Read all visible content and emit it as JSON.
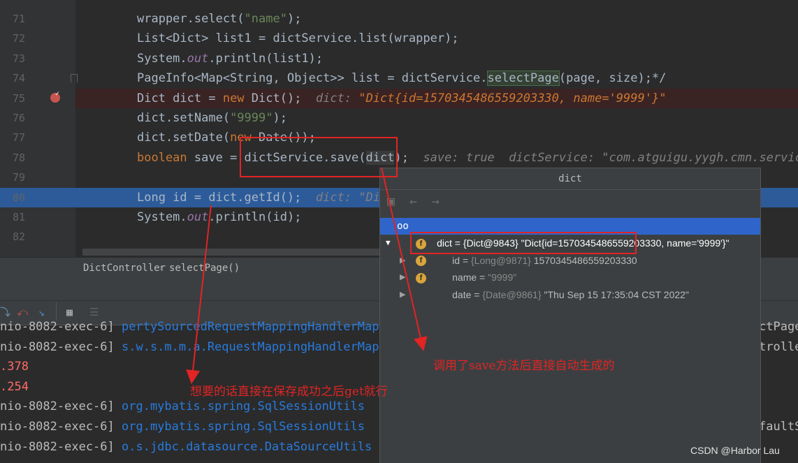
{
  "editor": {
    "lines": [
      {
        "no": "71",
        "segments": [
          {
            "t": "wrapper.select(",
            "c": ""
          },
          {
            "t": "\"name\"",
            "c": "str"
          },
          {
            "t": ");",
            "c": ""
          }
        ]
      },
      {
        "no": "72",
        "segments": [
          {
            "t": "List<Dict> list1 = dictService.list(wrapper);",
            "c": ""
          }
        ]
      },
      {
        "no": "73",
        "segments": [
          {
            "t": "System.",
            "c": ""
          },
          {
            "t": "out",
            "c": "it"
          },
          {
            "t": ".println(list1);",
            "c": ""
          }
        ]
      },
      {
        "no": "74",
        "segments": [
          {
            "t": "PageInfo<Map<String, Object>> list = dictService.",
            "c": ""
          },
          {
            "t": "selectPage",
            "c": "hl-sel"
          },
          {
            "t": "(page, size);*/",
            "c": ""
          }
        ]
      },
      {
        "no": "75",
        "segments": [
          {
            "t": "Dict dict = ",
            "c": ""
          },
          {
            "t": "new",
            "c": "kw"
          },
          {
            "t": " Dict();  ",
            "c": ""
          },
          {
            "t": "dict: ",
            "c": "hint"
          },
          {
            "t": "\"Dict{id=1570345486559203330, name='9999'}\"",
            "c": "hintv"
          }
        ]
      },
      {
        "no": "76",
        "segments": [
          {
            "t": "dict.setName(",
            "c": ""
          },
          {
            "t": "\"9999\"",
            "c": "str"
          },
          {
            "t": ");",
            "c": ""
          }
        ]
      },
      {
        "no": "77",
        "segments": [
          {
            "t": "dict.setDate(",
            "c": ""
          },
          {
            "t": "new",
            "c": "kw"
          },
          {
            "t": " Date());",
            "c": ""
          }
        ]
      },
      {
        "no": "78",
        "segments": [
          {
            "t": "boolean",
            "c": "kw"
          },
          {
            "t": " save = dictService.save(",
            "c": ""
          },
          {
            "t": "dict",
            "c": "hl-ref"
          },
          {
            "t": ");  ",
            "c": ""
          },
          {
            "t": "save: true  dictService: \"com.atguigu.yygh.cmn.service.",
            "c": "hint"
          }
        ]
      },
      {
        "no": "79",
        "segments": []
      },
      {
        "no": "80",
        "segments": [
          {
            "t": "Long id = dict.getId();  ",
            "c": ""
          },
          {
            "t": "dict: \"Dic",
            "c": "hint"
          }
        ]
      },
      {
        "no": "81",
        "segments": [
          {
            "t": "System.",
            "c": ""
          },
          {
            "t": "out",
            "c": "it"
          },
          {
            "t": ".println(id);",
            "c": ""
          }
        ]
      },
      {
        "no": "82",
        "segments": []
      }
    ]
  },
  "breadcrumb": {
    "class_name": "DictController",
    "separator": "›",
    "method": "selectPage()"
  },
  "console": {
    "lines": [
      {
        "thread": "nio-8082-exec-6] ",
        "cls": "pertySourcedRequestMappingHandlerMappi",
        "right": "ctPage"
      },
      {
        "thread": "nio-8082-exec-6] ",
        "cls": "s.w.s.m.m.a.RequestMappingHandlerMappi",
        "right": "trolle"
      },
      {
        "thread": ".378",
        "cls": "",
        "right": "",
        "red": true
      },
      {
        "thread": ".254",
        "cls": "",
        "right": "",
        "red": true
      },
      {
        "thread": "nio-8082-exec-6] ",
        "cls": "org.mybatis.spring.SqlSessionUtils",
        "right": ""
      },
      {
        "thread": "nio-8082-exec-6] ",
        "cls": "org.mybatis.spring.SqlSessionUtils",
        "right": "faultS"
      },
      {
        "thread": "nio-8082-exec-6] ",
        "cls": "o.s.jdbc.datasource.DataSourceUtils",
        "right": ""
      }
    ]
  },
  "popup": {
    "title": "dict",
    "root": {
      "name": "dict",
      "ref": "{Dict@9843}",
      "value": "\"Dict{id=1570345486559203330, name='9999'}\""
    },
    "fields": [
      {
        "name": "id",
        "ref": "{Long@9871}",
        "value": "1570345486559203330"
      },
      {
        "name": "name",
        "ref": "",
        "value": "\"9999\""
      },
      {
        "name": "date",
        "ref": "{Date@9861}",
        "value": "\"Thu Sep 15 17:35:04 CST 2022\""
      }
    ]
  },
  "annotations": {
    "note1": "想要的话直接在保存成功之后get就行",
    "note2": "调用了save方法后直接自动生成的"
  },
  "watermark": "CSDN @Harbor Lau",
  "colors": {
    "annotation_red": "#e12424",
    "exec_line": "#2d5b9a",
    "selection": "#2f65ca"
  }
}
